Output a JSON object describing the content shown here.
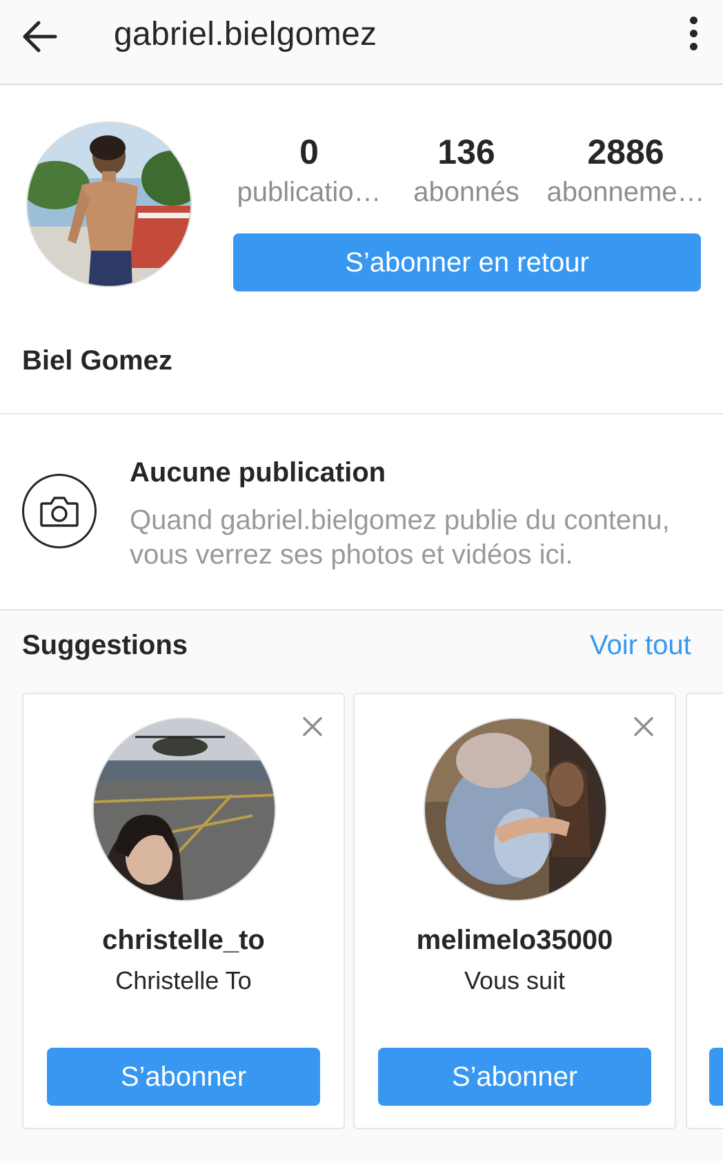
{
  "header": {
    "username": "gabriel.bielgomez",
    "back_icon": "arrow-left-icon",
    "more_icon": "more-vertical-icon"
  },
  "profile": {
    "stats": [
      {
        "value": "0",
        "label": "publicatio…"
      },
      {
        "value": "136",
        "label": "abonnés"
      },
      {
        "value": "2886",
        "label": "abonneme…"
      }
    ],
    "follow_back_label": "S’abonner en retour",
    "full_name": "Biel Gomez"
  },
  "empty_state": {
    "icon": "camera-icon",
    "title": "Aucune publication",
    "text": "Quand gabriel.bielgomez publie du contenu, vous verrez ses photos et vidéos ici."
  },
  "suggestions": {
    "title": "Suggestions",
    "see_all": "Voir tout",
    "cards": [
      {
        "username": "christelle_to",
        "subtitle": "Christelle To",
        "button": "S’abonner"
      },
      {
        "username": "melimelo35000",
        "subtitle": "Vous suit",
        "button": "S’abonner"
      }
    ]
  },
  "colors": {
    "accent": "#3897f0",
    "text": "#262626",
    "muted": "#8e8e8e"
  }
}
